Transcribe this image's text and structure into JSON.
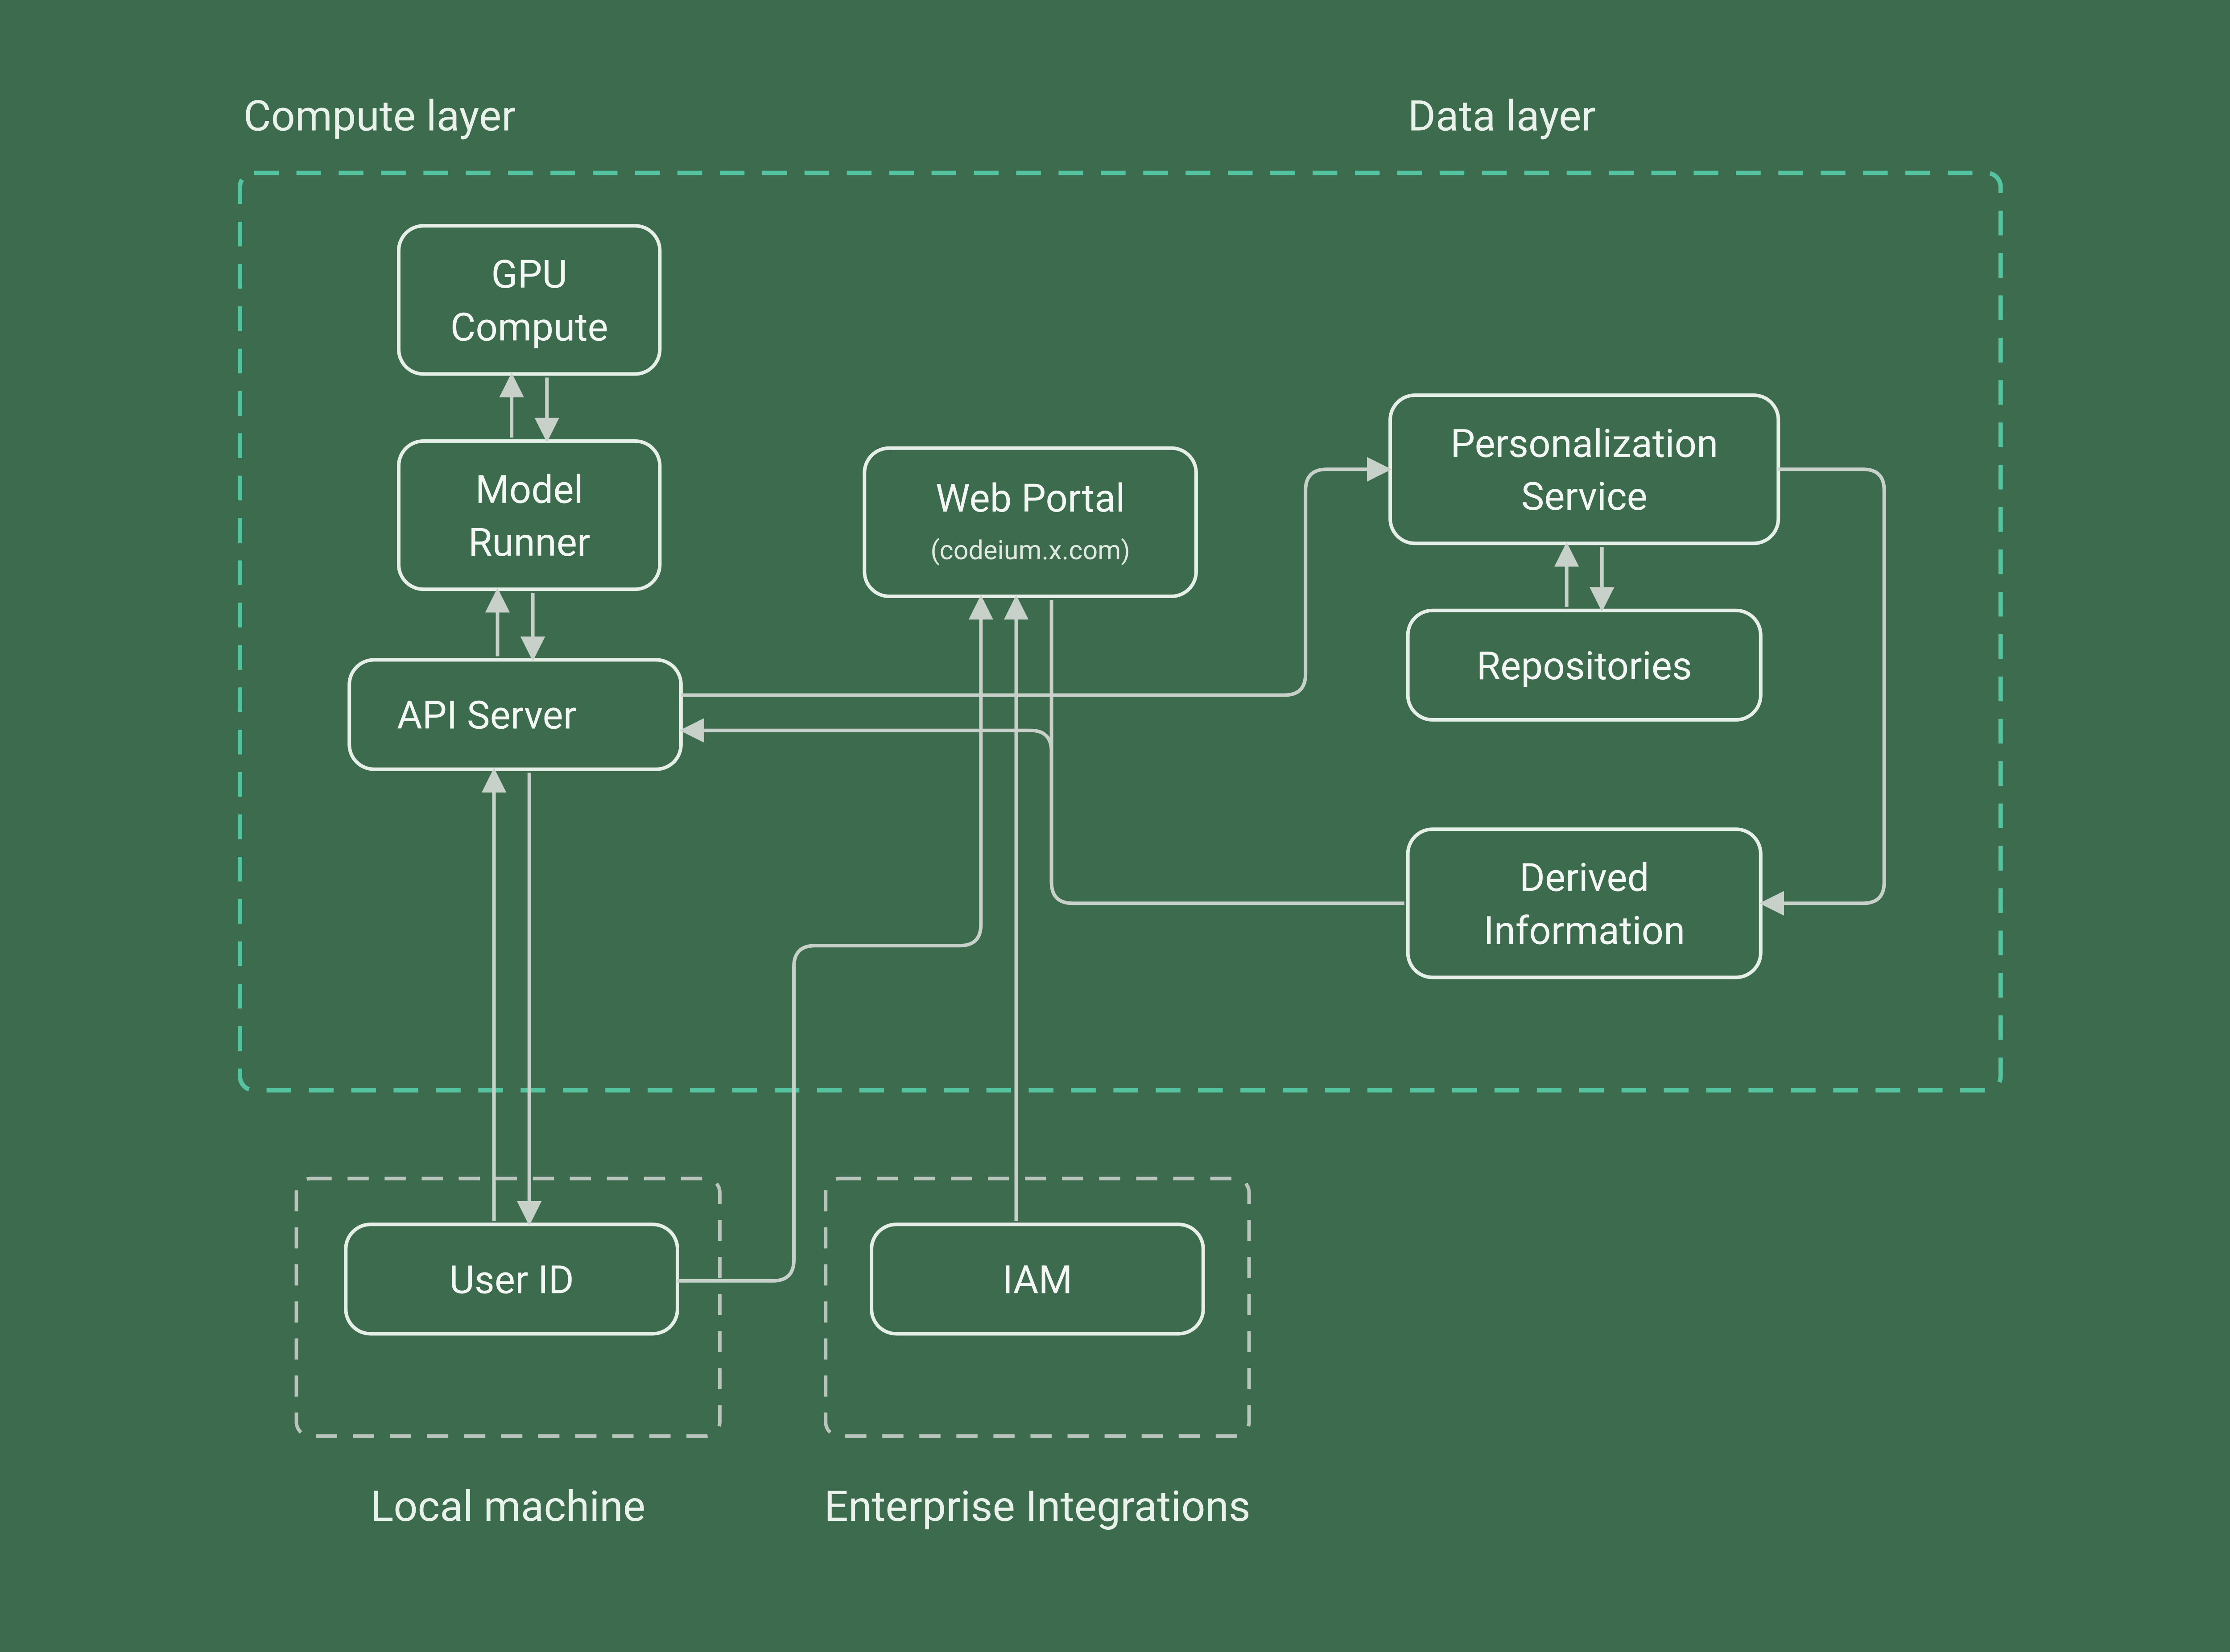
{
  "sections": {
    "compute_layer": "Compute layer",
    "data_layer": "Data layer",
    "local_machine": "Local machine",
    "enterprise_integrations": "Enterprise Integrations"
  },
  "nodes": {
    "gpu_compute": {
      "line1": "GPU",
      "line2": "Compute"
    },
    "model_runner": {
      "line1": "Model",
      "line2": "Runner"
    },
    "api_server": "API Server",
    "web_portal": {
      "title": "Web Portal",
      "subtitle": "(codeium.x.com)"
    },
    "personalization_service": {
      "line1": "Personalization",
      "line2": "Service"
    },
    "repositories": "Repositories",
    "derived_information": {
      "line1": "Derived",
      "line2": "Information"
    },
    "user_id": "User ID",
    "iam": "IAM"
  }
}
